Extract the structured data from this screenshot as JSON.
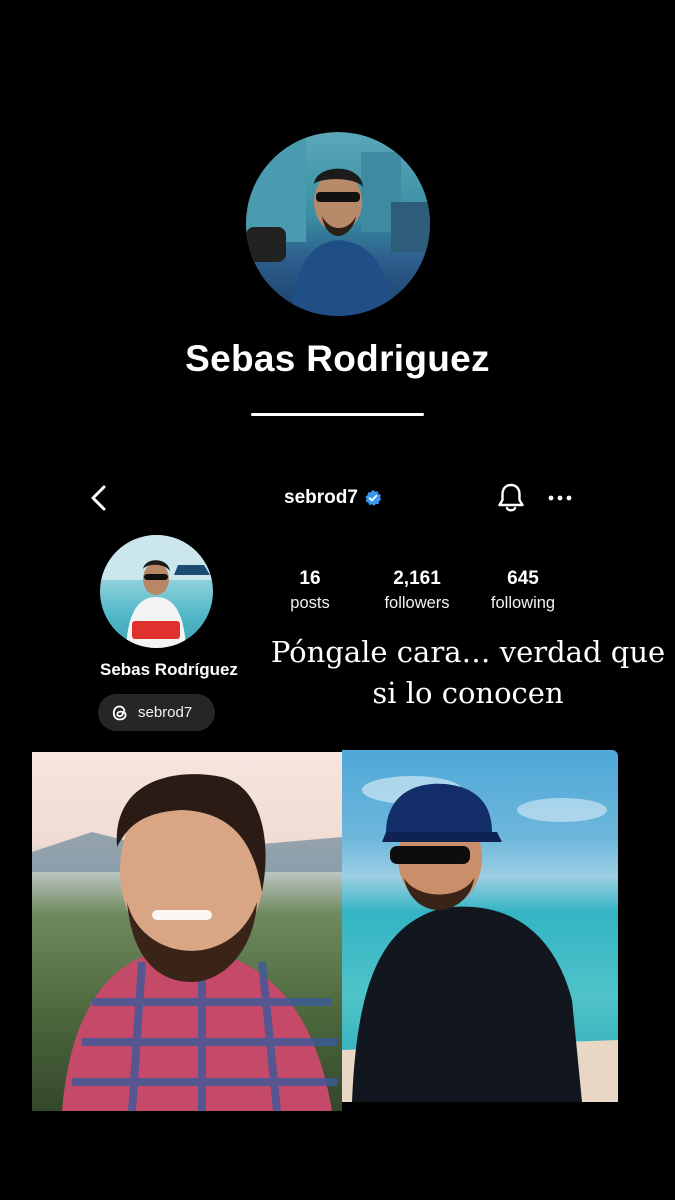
{
  "header": {
    "title": "Sebas Rodriguez"
  },
  "profile": {
    "username": "sebrod7",
    "display_name": "Sebas Rodríguez",
    "threads_handle": "sebrod7",
    "stats": [
      {
        "value": "16",
        "label": "posts"
      },
      {
        "value": "2,161",
        "label": "followers"
      },
      {
        "value": "645",
        "label": "following"
      }
    ]
  },
  "caption": {
    "line1": "Póngale cara… verdad que",
    "line2": "si lo conocen"
  },
  "icons": {
    "back": "chevron-left-icon",
    "verified": "verified-badge-icon",
    "notifications": "bell-icon",
    "more": "more-dots-icon",
    "threads": "threads-icon"
  },
  "colors": {
    "background": "#000000",
    "verified": "#3897f0",
    "pill": "#262626"
  }
}
